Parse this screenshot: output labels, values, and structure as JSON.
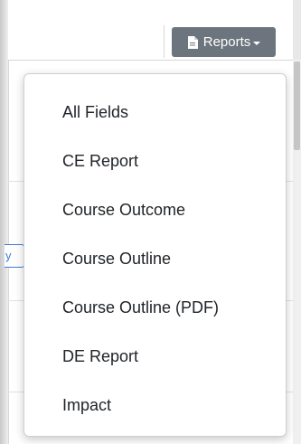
{
  "toolbar": {
    "reports_label": "Reports",
    "reports_icon": "document-icon"
  },
  "background": {
    "partial_button_text": "y"
  },
  "reports_menu": {
    "items": [
      {
        "label": "All Fields"
      },
      {
        "label": "CE Report"
      },
      {
        "label": "Course Outcome"
      },
      {
        "label": "Course Outline"
      },
      {
        "label": "Course Outline (PDF)"
      },
      {
        "label": "DE Report"
      },
      {
        "label": "Impact"
      }
    ]
  },
  "colors": {
    "button_bg": "#6c757d",
    "link_blue": "#3b7ddd",
    "text": "#212529"
  }
}
